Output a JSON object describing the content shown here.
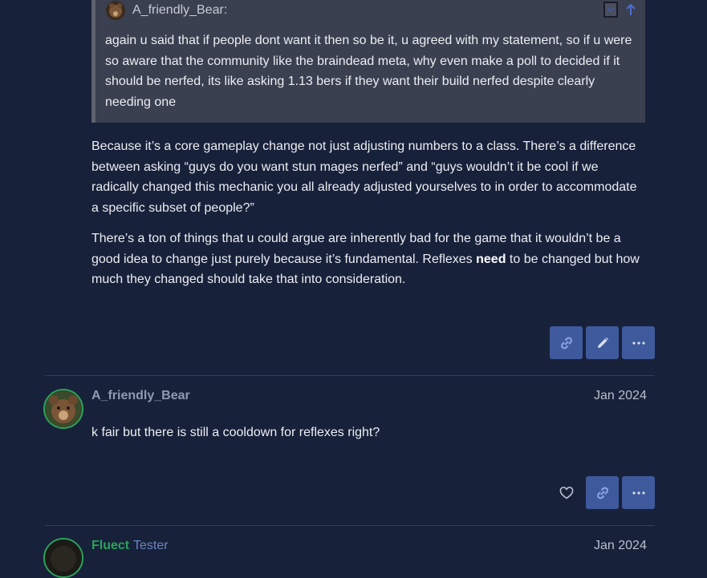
{
  "quote": {
    "author": "A_friendly_Bear:",
    "text": "again u said that if people dont want it then so be it, u agreed with my statement, so if u were so aware that the community like the braindead meta, why even make a poll to decided if it should be nerfed, its like asking 1.13 bers if they want their build nerfed despite clearly needing one"
  },
  "post1": {
    "para1": "Because it’s a core gameplay change not just adjusting numbers to a class. There’s a difference between asking “guys do you want stun mages nerfed” and “guys wouldn’t it be cool if we radically changed this mechanic you all already adjusted yourselves to in order to accommodate a specific subset of people?”",
    "para2_before": "There’s a ton of things that u could argue are inherently bad for the game that it wouldn’t be a good idea to change just purely because it’s fundamental. Reflexes ",
    "para2_bold": "need",
    "para2_after": " to be changed but how much they changed should take that into consideration.",
    "actions": {
      "link_icon": "link-icon",
      "edit_icon": "pencil-icon",
      "more_icon": "ellipsis-icon"
    }
  },
  "post2": {
    "username": "A_friendly_Bear",
    "date": "Jan 2024",
    "text": "k fair but there is still a cooldown for reflexes right?",
    "actions": {
      "like_icon": "heart-icon",
      "link_icon": "link-icon",
      "more_icon": "ellipsis-icon"
    }
  },
  "post3": {
    "username": "Fluect",
    "title": "Tester",
    "date": "Jan 2024"
  },
  "colors": {
    "background": "#18213a",
    "button": "#3f5a9c",
    "username_green": "#2ba35a",
    "username_gray": "#8f9bb0",
    "title_blue": "#6d84c3"
  }
}
